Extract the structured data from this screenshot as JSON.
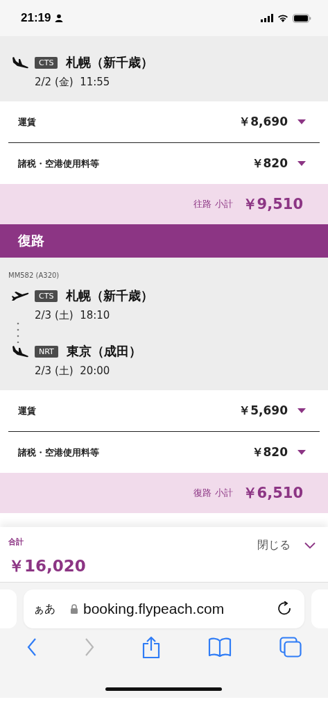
{
  "status_bar": {
    "time": "21:19"
  },
  "outbound": {
    "segments": [
      {
        "kind": "arrival",
        "code": "CTS",
        "city": "札幌（新千歳）",
        "date": "2/2 (金)",
        "time": "11:55"
      }
    ],
    "fees": [
      {
        "label": "運賃",
        "amount": "￥8,690"
      },
      {
        "label": "諸税・空港使用料等",
        "amount": "￥820"
      }
    ],
    "subtotal": {
      "label": "往路 小計",
      "amount": "￥9,510"
    }
  },
  "return": {
    "title": "復路",
    "flight": "MM582 (A320)",
    "segments": [
      {
        "kind": "departure",
        "code": "CTS",
        "city": "札幌（新千歳）",
        "date": "2/3 (土)",
        "time": "18:10"
      },
      {
        "kind": "arrival",
        "code": "NRT",
        "city": "東京（成田）",
        "date": "2/3 (土)",
        "time": "20:00"
      }
    ],
    "fees": [
      {
        "label": "運賃",
        "amount": "￥5,690"
      },
      {
        "label": "諸税・空港使用料等",
        "amount": "￥820"
      }
    ],
    "subtotal": {
      "label": "復路 小計",
      "amount": "￥6,510"
    }
  },
  "total": {
    "label": "合計",
    "amount": "￥16,020",
    "close": "閉じる"
  },
  "browser": {
    "text_size": "ぁあ",
    "url": "booking.flypeach.com",
    "toolbar": [
      {
        "kind": "back",
        "disabled": false
      },
      {
        "kind": "forward",
        "disabled": true
      },
      {
        "kind": "share",
        "disabled": false
      },
      {
        "kind": "bookmarks",
        "disabled": false
      },
      {
        "kind": "tabs",
        "disabled": false
      }
    ]
  }
}
